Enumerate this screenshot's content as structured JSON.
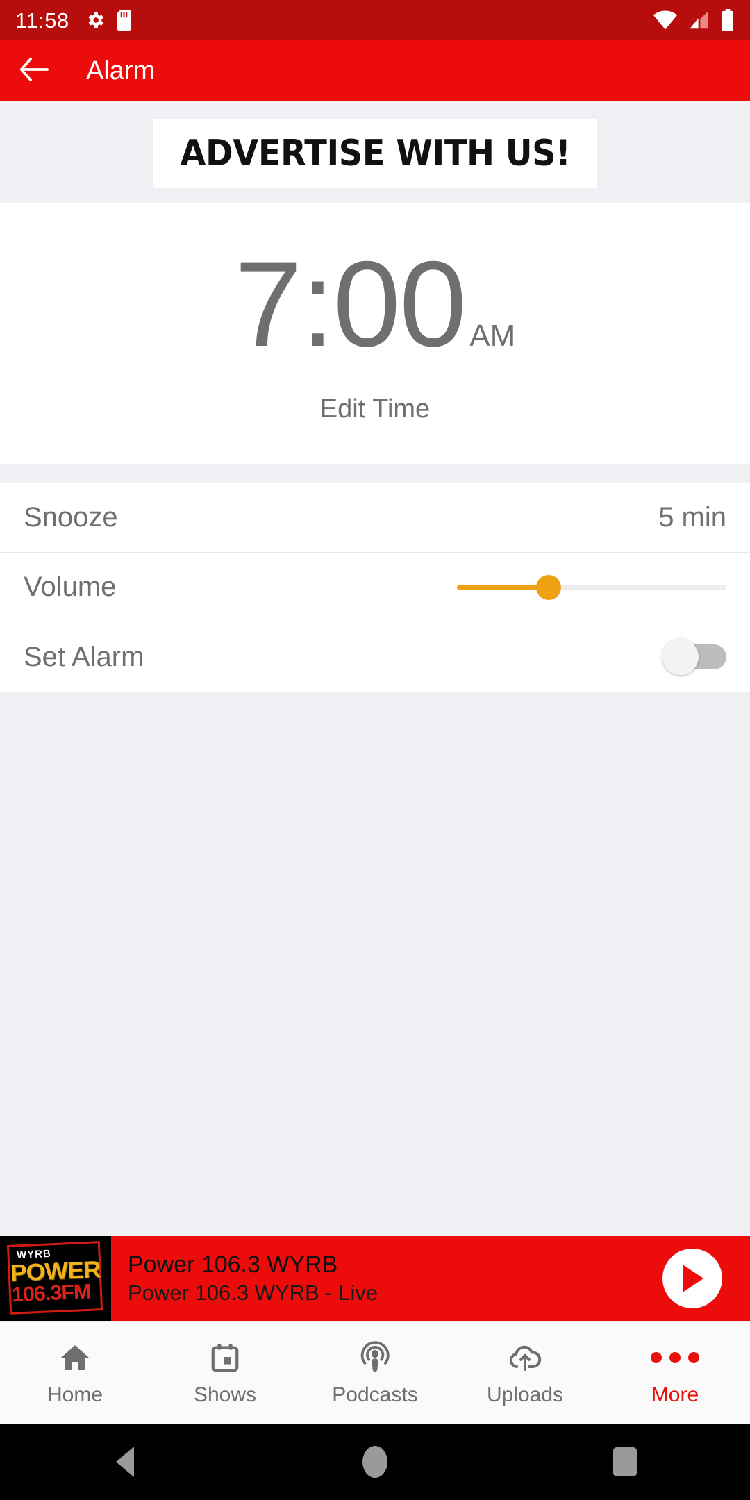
{
  "status_bar": {
    "time": "11:58",
    "icons": [
      "gear-icon",
      "sd-card-icon"
    ],
    "right_icons": [
      "wifi-icon",
      "cellular-signal-icon",
      "battery-icon"
    ],
    "background_color": "#b70d0d"
  },
  "app_bar": {
    "back_label": "back-arrow",
    "title": "Alarm",
    "background_color": "#ec0c0c"
  },
  "ad_banner": {
    "text": "ADVERTISE WITH US!"
  },
  "alarm": {
    "time": "7:00",
    "period": "AM",
    "edit_label": "Edit Time"
  },
  "settings": {
    "rows": [
      {
        "label": "Snooze",
        "value": "5 min",
        "type": "value"
      },
      {
        "label": "Volume",
        "type": "slider",
        "percent": 34,
        "accent": "#f0a111"
      },
      {
        "label": "Set Alarm",
        "type": "toggle",
        "enabled": false
      }
    ]
  },
  "now_playing": {
    "station_logo": {
      "call_sign": "WYRB",
      "brand": "POWER",
      "frequency": "106.3FM"
    },
    "title": "Power 106.3 WYRB",
    "subtitle": "Power 106.3 WYRB - Live",
    "play_button": "play-icon",
    "background_color": "#ec0c0c"
  },
  "bottom_nav": {
    "active_index": 4,
    "items": [
      {
        "label": "Home",
        "icon": "home-icon"
      },
      {
        "label": "Shows",
        "icon": "calendar-icon"
      },
      {
        "label": "Podcasts",
        "icon": "podcast-icon"
      },
      {
        "label": "Uploads",
        "icon": "cloud-upload-icon"
      },
      {
        "label": "More",
        "icon": "more-dots-icon"
      }
    ]
  },
  "android_nav": {
    "buttons": [
      "back-button",
      "home-button",
      "recents-button"
    ]
  }
}
